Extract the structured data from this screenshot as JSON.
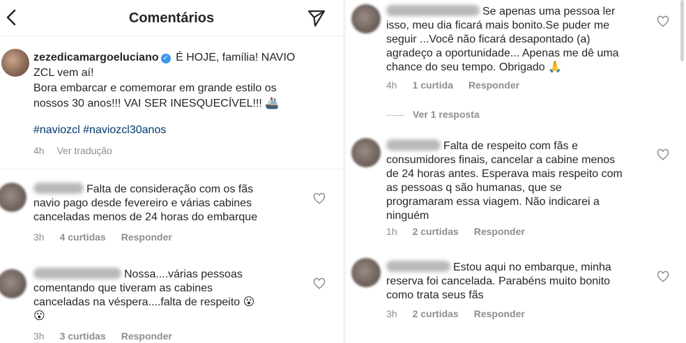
{
  "header": {
    "title": "Comentários",
    "back_icon": "chevron-left-icon",
    "send_icon": "paper-plane-icon"
  },
  "caption": {
    "username": "zezedicamargoeluciano",
    "line1": " É HOJE, família! NAVIO",
    "line2": "ZCL vem aí!",
    "line3": "Bora embarcar e comemorar em grande estilo os",
    "line4": "nossos 30 anos!!! VAI SER INESQUECÍVEL!!! 🚢",
    "hashtag1": "#naviozcl",
    "hashtag2": "#naviozcl30anos",
    "time": "4h",
    "translate": "Ver tradução",
    "verified_color": "#3897f0"
  },
  "left_comments": [
    {
      "lines": [
        "Falta de consideração com os fãs",
        "navio pago desde fevereiro e várias cabines",
        "canceladas menos de 24 horas do embarque"
      ],
      "time": "3h",
      "likes": "4 curtidas",
      "reply": "Responder"
    },
    {
      "lines": [
        "Nossa....várias pessoas",
        "comentando que tiveram as cabines",
        "canceladas na véspera....falta de respeito 😮",
        "😮"
      ],
      "time": "3h",
      "likes": "3 curtidas",
      "reply": "Responder"
    }
  ],
  "right_comments": [
    {
      "lines": [
        "Se apenas uma pessoa ler",
        "isso, meu dia ficará mais bonito.Se puder me",
        "seguir ...Você não ficará desapontado (a)",
        "agradeço a oportunidade... Apenas me dê uma",
        "chance do seu tempo. Obrigado 🙏"
      ],
      "time": "4h",
      "likes": "1 curtida",
      "reply": "Responder",
      "view_replies": "Ver 1 resposta"
    },
    {
      "lines": [
        "Falta de respeito com fãs e",
        "consumidores finais, cancelar a cabine menos",
        "de 24 horas antes. Esperava mais respeito com",
        "as pessoas q são humanas, que se",
        "programaram essa viagem. Não indicarei a",
        "ninguém"
      ],
      "time": "1h",
      "likes": "2 curtidas",
      "reply": "Responder"
    },
    {
      "lines": [
        "Estou aqui no embarque, minha",
        "reserva foi cancelada. Parabéns muito bonito",
        "como trata seus fãs"
      ],
      "time": "3h",
      "likes": "2 curtidas",
      "reply": "Responder"
    }
  ]
}
